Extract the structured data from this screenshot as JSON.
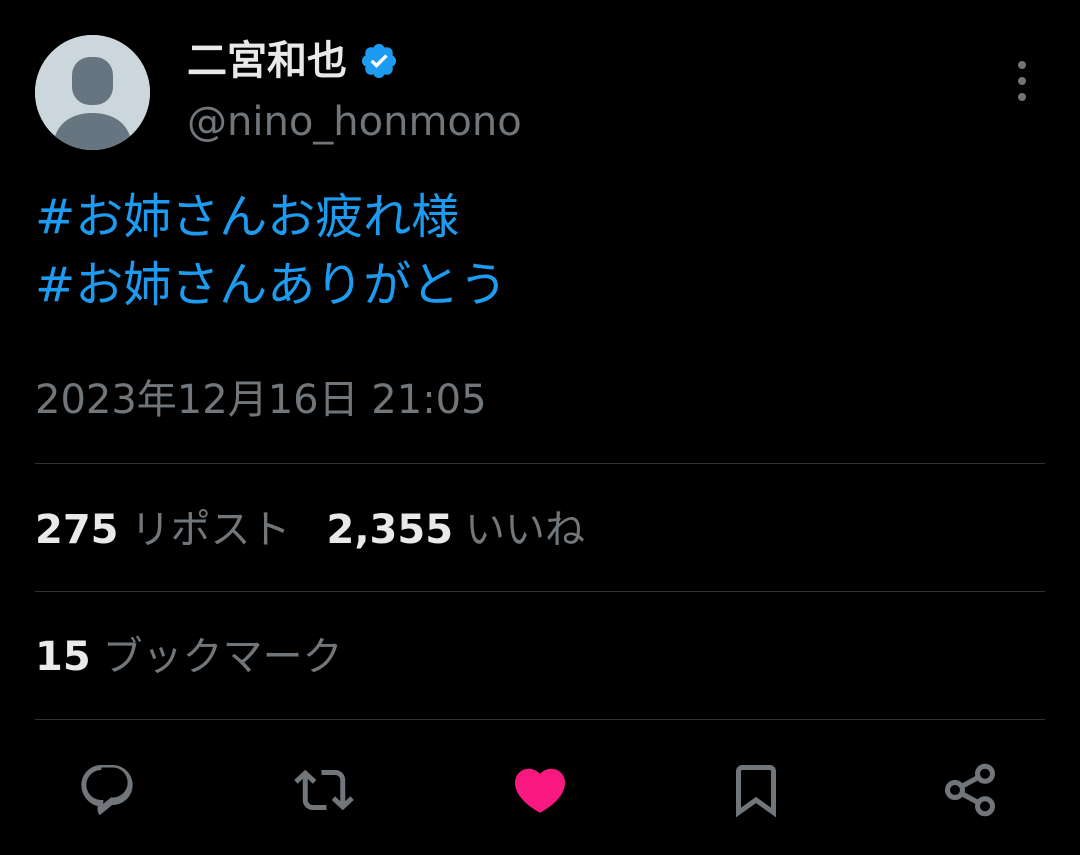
{
  "user": {
    "display_name": "二宮和也",
    "handle": "@nino_honmono",
    "verified": true
  },
  "tweet": {
    "hashtags": [
      "#お姉さんお疲れ様",
      "#お姉さんありがとう"
    ],
    "timestamp": "2023年12月16日 21:05"
  },
  "stats": {
    "reposts_count": "275",
    "reposts_label": "リポスト",
    "likes_count": "2,355",
    "likes_label": "いいね",
    "bookmarks_count": "15",
    "bookmarks_label": "ブックマーク"
  },
  "colors": {
    "accent": "#1d9bf0",
    "like_active": "#f91880",
    "muted": "#71767b",
    "text": "#e7e9ea"
  },
  "icons": [
    "reply-icon",
    "repost-icon",
    "like-icon",
    "bookmark-icon",
    "share-icon",
    "more-icon",
    "verified-badge-icon"
  ]
}
